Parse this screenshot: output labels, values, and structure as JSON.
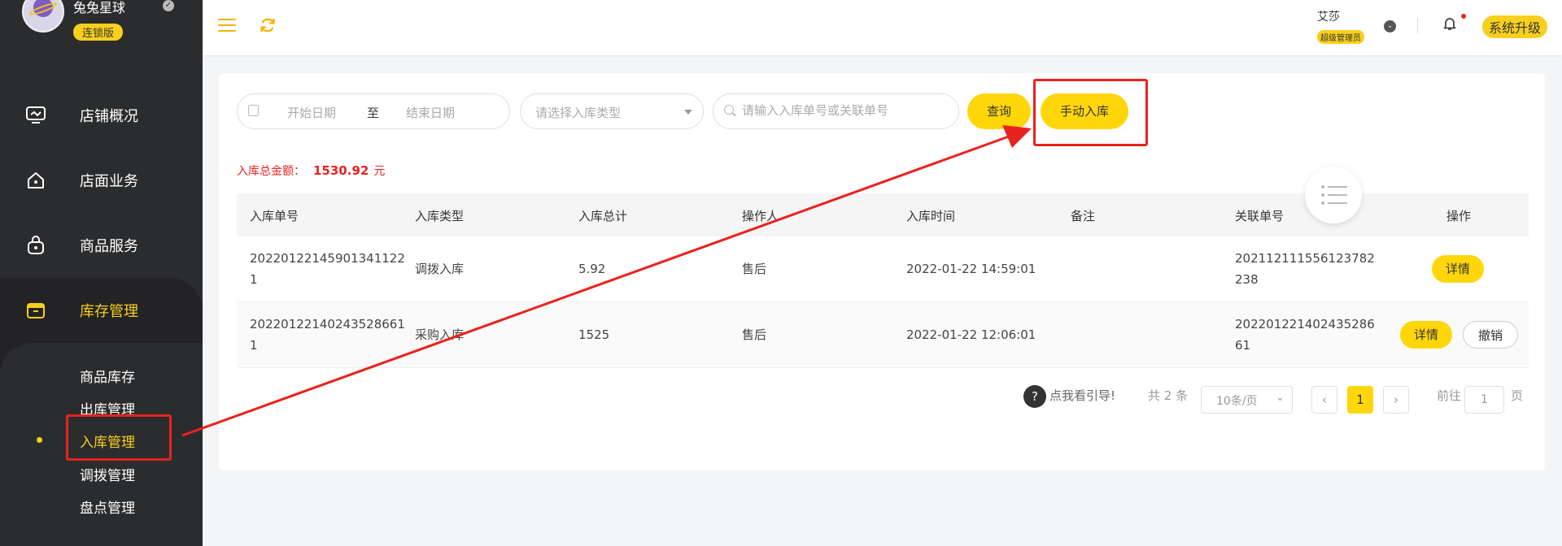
{
  "brand": {
    "name": "兔兔星球",
    "badge": "连锁版"
  },
  "sidebar": {
    "items": [
      {
        "label": "店铺概况",
        "icon": "monitor-icon"
      },
      {
        "label": "店面业务",
        "icon": "home-icon"
      },
      {
        "label": "商品服务",
        "icon": "bag-icon"
      },
      {
        "label": "库存管理",
        "icon": "box-icon"
      }
    ],
    "subitems": [
      {
        "label": "商品库存"
      },
      {
        "label": "出库管理"
      },
      {
        "label": "入库管理"
      },
      {
        "label": "调拨管理"
      },
      {
        "label": "盘点管理"
      }
    ]
  },
  "header": {
    "user_name": "艾莎",
    "user_role": "超级管理员",
    "upgrade_label": "系统升级"
  },
  "filters": {
    "start_placeholder": "开始日期",
    "range_sep": "至",
    "end_placeholder": "结束日期",
    "type_placeholder": "请选择入库类型",
    "search_placeholder": "请输入入库单号或关联单号",
    "query_label": "查询",
    "manual_label": "手动入库"
  },
  "summary": {
    "label": "入库总金额：",
    "amount": "1530.92",
    "unit": "元"
  },
  "table": {
    "headers": [
      "入库单号",
      "入库类型",
      "入库总计",
      "操作人",
      "入库时间",
      "备注",
      "关联单号",
      "操作"
    ],
    "rows": [
      {
        "no_line1": "20220122145901341122",
        "no_line2": "1",
        "type": "调拨入库",
        "total": "5.92",
        "operator": "售后",
        "time": "2022-01-22 14:59:01",
        "remark": "",
        "rel_line1": "202112111556123782",
        "rel_line2": "238",
        "actions": [
          "详情"
        ]
      },
      {
        "no_line1": "20220122140243528661",
        "no_line2": "1",
        "type": "采购入库",
        "total": "1525",
        "operator": "售后",
        "time": "2022-01-22 12:06:01",
        "remark": "",
        "rel_line1": "202201221402435286",
        "rel_line2": "61",
        "actions": [
          "详情",
          "撤销"
        ]
      }
    ]
  },
  "pagination": {
    "guide": "点我看引导!",
    "total": "共 2 条",
    "page_size": "10条/页",
    "current_page": "1",
    "goto_prefix": "前往",
    "goto_value": "1",
    "goto_suffix": "页"
  },
  "colors": {
    "accent": "#ffd60a",
    "sidebar": "#2b2c2e",
    "annotation": "#e8231f",
    "amount": "#e8231f"
  }
}
